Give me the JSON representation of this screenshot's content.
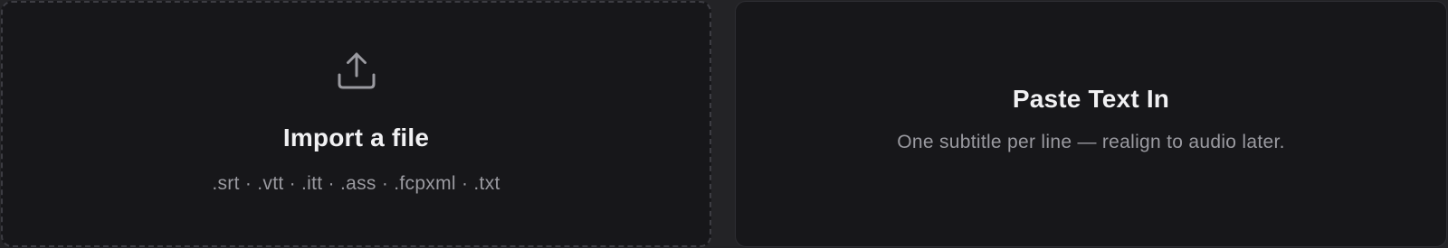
{
  "import_card": {
    "icon": "upload-icon",
    "title": "Import a file",
    "formats": ".srt · .vtt · .itt · .ass · .fcpxml · .txt"
  },
  "paste_card": {
    "title": "Paste Text In",
    "subtitle": "One subtitle per line — realign to audio later."
  },
  "colors": {
    "background": "#232326",
    "card": "#17171a",
    "title_text": "#f1f1f3",
    "muted_text": "#9a9aa0",
    "dashed_border": "#3c3c42"
  }
}
